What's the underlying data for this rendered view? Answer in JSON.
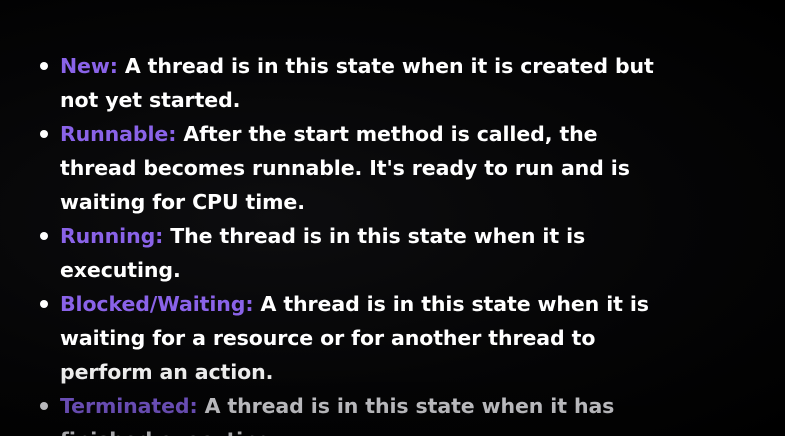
{
  "colors": {
    "background": "#000000",
    "text": "#ffffff",
    "term": "#8a63e8"
  },
  "states": [
    {
      "term": "New:",
      "description": " A thread is in this state when it is created but not yet started."
    },
    {
      "term": "Runnable:",
      "description": " After the start method is called, the thread becomes runnable. It's ready to run and is waiting for CPU time."
    },
    {
      "term": "Running:",
      "description": " The thread is in this state when it is executing."
    },
    {
      "term": "Blocked/Waiting:",
      "description": " A thread is in this state when it is waiting for a resource or for another thread to perform an action."
    },
    {
      "term": "Terminated:",
      "description": " A thread is in this state when it has finished executing."
    }
  ]
}
